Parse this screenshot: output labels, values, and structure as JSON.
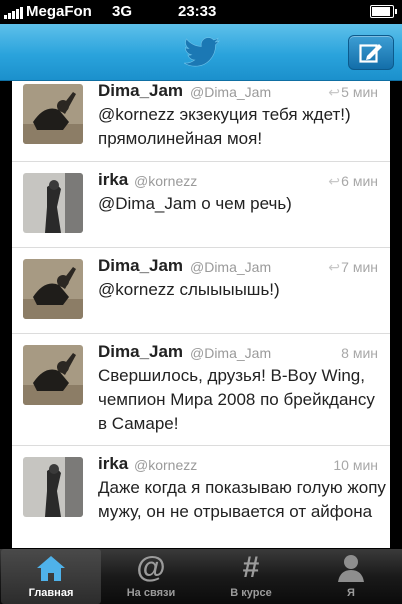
{
  "status_bar": {
    "carrier": "MegaFon",
    "network": "3G",
    "time": "23:33"
  },
  "navbar": {
    "logo_icon": "twitter-bird-icon",
    "compose_icon": "compose-icon"
  },
  "tweets": [
    {
      "name": "Dima_Jam",
      "handle": "@Dima_Jam",
      "time": "5 мин",
      "text": "@kornezz экзекуция тебя ждет!) прямолинейная моя!"
    },
    {
      "name": "irka",
      "handle": "@kornezz",
      "time": "6 мин",
      "text": "@Dima_Jam о чем речь)"
    },
    {
      "name": "Dima_Jam",
      "handle": "@Dima_Jam",
      "time": "7 мин",
      "text": "@kornezz слыыыышь!)"
    },
    {
      "name": "Dima_Jam",
      "handle": "@Dima_Jam",
      "time": "8 мин",
      "text": "Свершилось, друзья! B-Boy Wing, чемпион Мира 2008 по брейкдансу в Самаре!"
    },
    {
      "name": "irka",
      "handle": "@kornezz",
      "time": "10 мин",
      "text": "Даже когда я показываю голую жопу мужу, он не отрывается от айфона"
    }
  ],
  "tabs": [
    {
      "label": "Главная",
      "icon": "home-icon",
      "glyph": "",
      "active": true
    },
    {
      "label": "На связи",
      "icon": "at-icon",
      "glyph": "@",
      "active": false
    },
    {
      "label": "В курсе",
      "icon": "hashtag-icon",
      "glyph": "#",
      "active": false
    },
    {
      "label": "Я",
      "icon": "profile-icon",
      "glyph": "",
      "active": false
    }
  ]
}
